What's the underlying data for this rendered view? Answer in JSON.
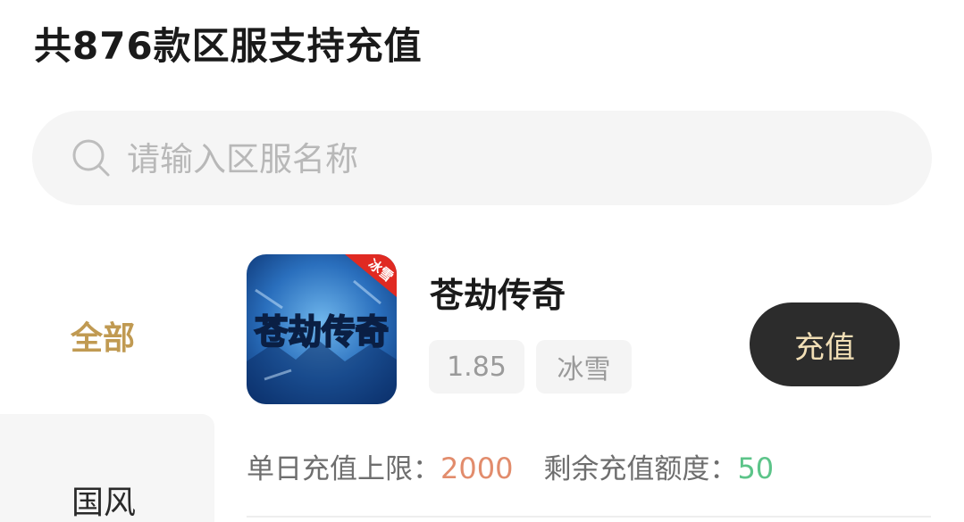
{
  "header": {
    "title": "共876款区服支持充值"
  },
  "search": {
    "placeholder": "请输入区服名称"
  },
  "sidebar": {
    "items": [
      {
        "label": "全部",
        "active": true
      },
      {
        "label": "国风",
        "active": false
      }
    ]
  },
  "game": {
    "name": "苍劫传奇",
    "icon_text": "苍劫传奇",
    "icon_badge": "冰雪",
    "tags": [
      "1.85",
      "冰雪"
    ],
    "recharge_label": "充值",
    "daily_limit_label": "单日充值上限：",
    "daily_limit_value": "2000",
    "remaining_label": "剩余充值额度：",
    "remaining_value": "50"
  },
  "colors": {
    "accent_gold": "#c09a52",
    "button_bg": "#2c2c2c",
    "button_text": "#f2dfb6",
    "daily_value": "#e28c6c",
    "remaining_value": "#5cc489"
  }
}
